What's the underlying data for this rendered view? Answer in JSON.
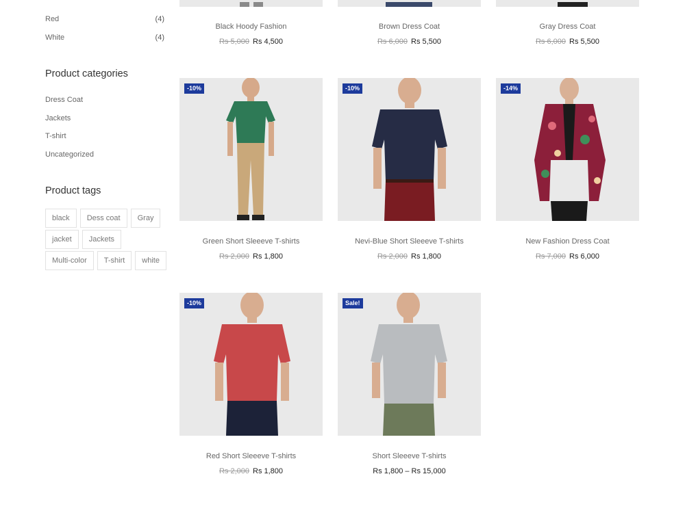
{
  "sidebar": {
    "colors": [
      {
        "label": "Red",
        "count": "(4)"
      },
      {
        "label": "White",
        "count": "(4)"
      }
    ],
    "categories_heading": "Product categories",
    "categories": [
      "Dress Coat",
      "Jackets",
      "T-shirt",
      "Uncategorized"
    ],
    "tags_heading": "Product tags",
    "tags": [
      "black",
      "Dess coat",
      "Gray",
      "jacket",
      "Jackets",
      "Multi-color",
      "T-shirt",
      "white"
    ]
  },
  "products_top_row": [
    {
      "name": "Black Hoody Fashion",
      "old_price": "Rs 5,000",
      "price": "Rs 4,500",
      "shirt_color": "#9a9a9a"
    },
    {
      "name": "Brown Dress Coat",
      "old_price": "Rs 6,000",
      "price": "Rs 5,500",
      "shirt_color": "#3b4a6b"
    },
    {
      "name": "Gray Dress Coat",
      "old_price": "Rs 6,000",
      "price": "Rs 5,500",
      "shirt_color": "#2a2a2a"
    }
  ],
  "products": [
    {
      "name": "Green Short Sleeeve T-shirts",
      "badge": "-10%",
      "old_price": "Rs 2,000",
      "price": "Rs 1,800",
      "shirt_color": "#2e7a56",
      "pants_color": "#c9a87a",
      "style": "full"
    },
    {
      "name": "Nevi-Blue Short Sleeeve T-shirts",
      "badge": "-10%",
      "old_price": "Rs 2,000",
      "price": "Rs 1,800",
      "shirt_color": "#262c45",
      "pants_color": "#7a1c22",
      "style": "close"
    },
    {
      "name": "New Fashion Dress Coat",
      "badge": "-14%",
      "old_price": "Rs 7,000",
      "price": "Rs 6,000",
      "shirt_color": "#8c1f3a",
      "pants_color": "#1a1a1a",
      "style": "coat"
    },
    {
      "name": "Red Short Sleeeve T-shirts",
      "badge": "-10%",
      "old_price": "Rs 2,000",
      "price": "Rs 1,800",
      "shirt_color": "#c8484a",
      "pants_color": "#1c2238",
      "style": "close"
    },
    {
      "name": "Short Sleeeve T-shirts",
      "badge": "Sale!",
      "old_price": "",
      "price": "Rs 1,800 – Rs 15,000",
      "shirt_color": "#b9bcbf",
      "pants_color": "#6d7a5a",
      "style": "close"
    }
  ],
  "colors": {
    "badge": "#1d3b9c",
    "image_bg": "#e9e9e9"
  }
}
